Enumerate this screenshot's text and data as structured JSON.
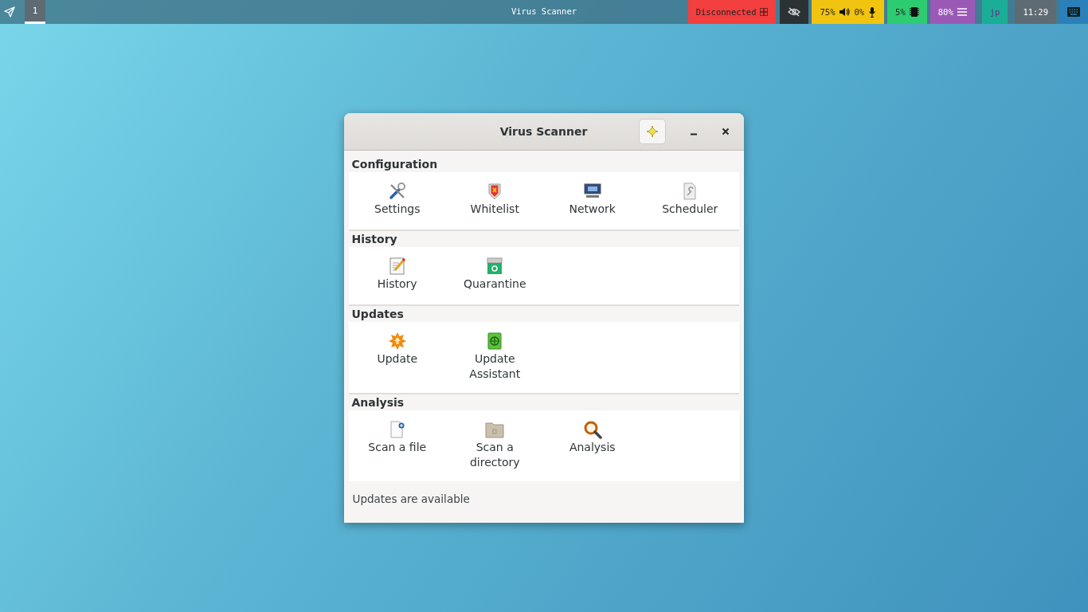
{
  "top_bar": {
    "workspaces": [
      {
        "label": "1",
        "selected": true
      }
    ],
    "title": "Virus Scanner",
    "status_blocks": [
      {
        "kind": "network",
        "text": "Disconnected",
        "color": "#f43f3f"
      },
      {
        "kind": "privacy",
        "color": "#2c3134"
      },
      {
        "kind": "audio",
        "text": "75%",
        "text_2": "0%",
        "color": "#f1c40f"
      },
      {
        "kind": "cpu",
        "text": "5%",
        "color": "#2ecc71"
      },
      {
        "kind": "memory",
        "text": "80%",
        "color": "#9b59b6"
      },
      {
        "kind": "layout",
        "text": "jp",
        "color": "#1aae96"
      },
      {
        "kind": "clock",
        "text": "11:29",
        "color": "#5f6b73"
      },
      {
        "kind": "keyboard",
        "color": "#2a80b9"
      }
    ]
  },
  "window": {
    "title": "Virus Scanner",
    "sections": [
      {
        "title": "Configuration",
        "items": [
          {
            "kind": "settings",
            "label": "Settings"
          },
          {
            "kind": "whitelist",
            "label": "Whitelist"
          },
          {
            "kind": "network",
            "label": "Network"
          },
          {
            "kind": "scheduler",
            "label": "Scheduler"
          }
        ]
      },
      {
        "title": "History",
        "items": [
          {
            "kind": "history",
            "label": "History"
          },
          {
            "kind": "quarantine",
            "label": "Quarantine"
          }
        ]
      },
      {
        "title": "Updates",
        "items": [
          {
            "kind": "update",
            "label": "Update"
          },
          {
            "kind": "update-assistant",
            "label": "Update Assistant"
          }
        ]
      },
      {
        "title": "Analysis",
        "items": [
          {
            "kind": "scan-file",
            "label": "Scan a file"
          },
          {
            "kind": "scan-directory",
            "label": "Scan a directory"
          },
          {
            "kind": "analysis",
            "label": "Analysis"
          }
        ]
      }
    ],
    "status": "Updates are available"
  }
}
